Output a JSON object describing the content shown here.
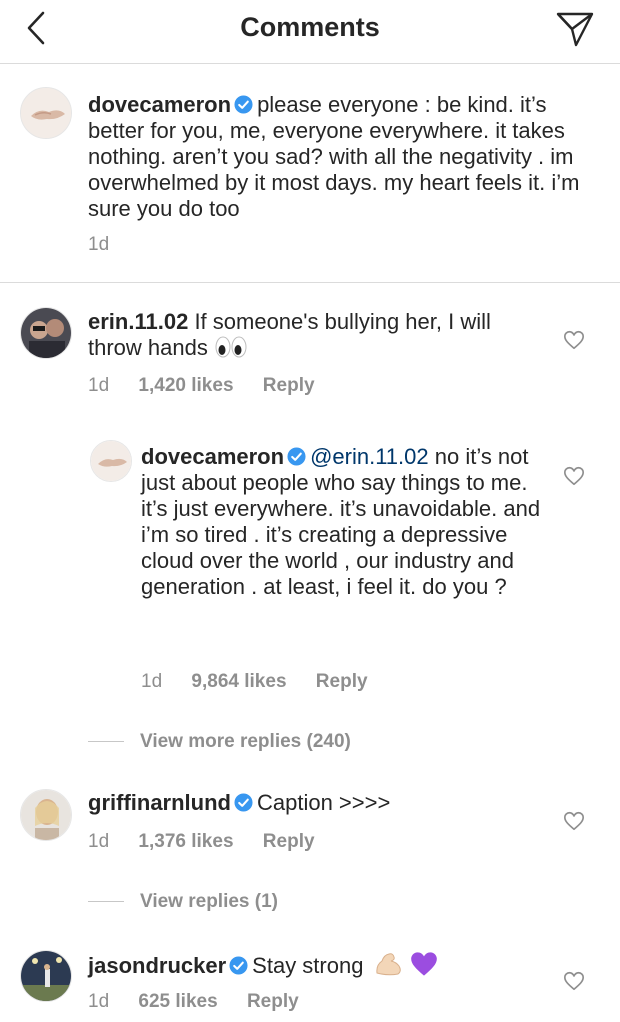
{
  "header": {
    "title": "Comments"
  },
  "caption": {
    "username": "dovecameron",
    "text": "please everyone : be kind. it’s better for you, me, everyone everywhere. it takes nothing. aren’t you sad? with all the negativity . im overwhelmed by it most days. my heart feels it. i’m sure you do too",
    "time": "1d"
  },
  "comments": [
    {
      "username": "erin.11.02",
      "text": "If someone's bullying her, I will throw hands",
      "time": "1d",
      "likes": "1,420 likes",
      "reply": "Reply"
    },
    {
      "username": "dovecameron",
      "mention": "@erin.11.02",
      "text": "no it’s not just about people who say things to me. it’s just everywhere. it’s unavoidable. and i’m so tired . it’s creating a depressive cloud over the world , our industry and generation . at least, i feel it. do you ?",
      "time": "1d",
      "likes": "9,864 likes",
      "reply": "Reply"
    },
    {
      "username": "griffinarnlund",
      "text": "Caption >>>>",
      "time": "1d",
      "likes": "1,376 likes",
      "reply": "Reply"
    },
    {
      "username": "jasondrucker",
      "text": "Stay strong",
      "time": "1d",
      "likes": "625 likes",
      "reply": "Reply"
    }
  ],
  "view_more_replies": "View more replies (240)",
  "view_replies": "View replies (1)",
  "icons": {
    "back": "chevron-left-icon",
    "send": "paper-plane-icon",
    "like": "heart-outline-icon",
    "verified": "verified-badge-icon"
  },
  "colors": {
    "verified": "#3897f0",
    "meta": "#8e8e8e",
    "text": "#262626",
    "divider": "#dbdbdb",
    "purple_heart": "#9b4de0"
  }
}
